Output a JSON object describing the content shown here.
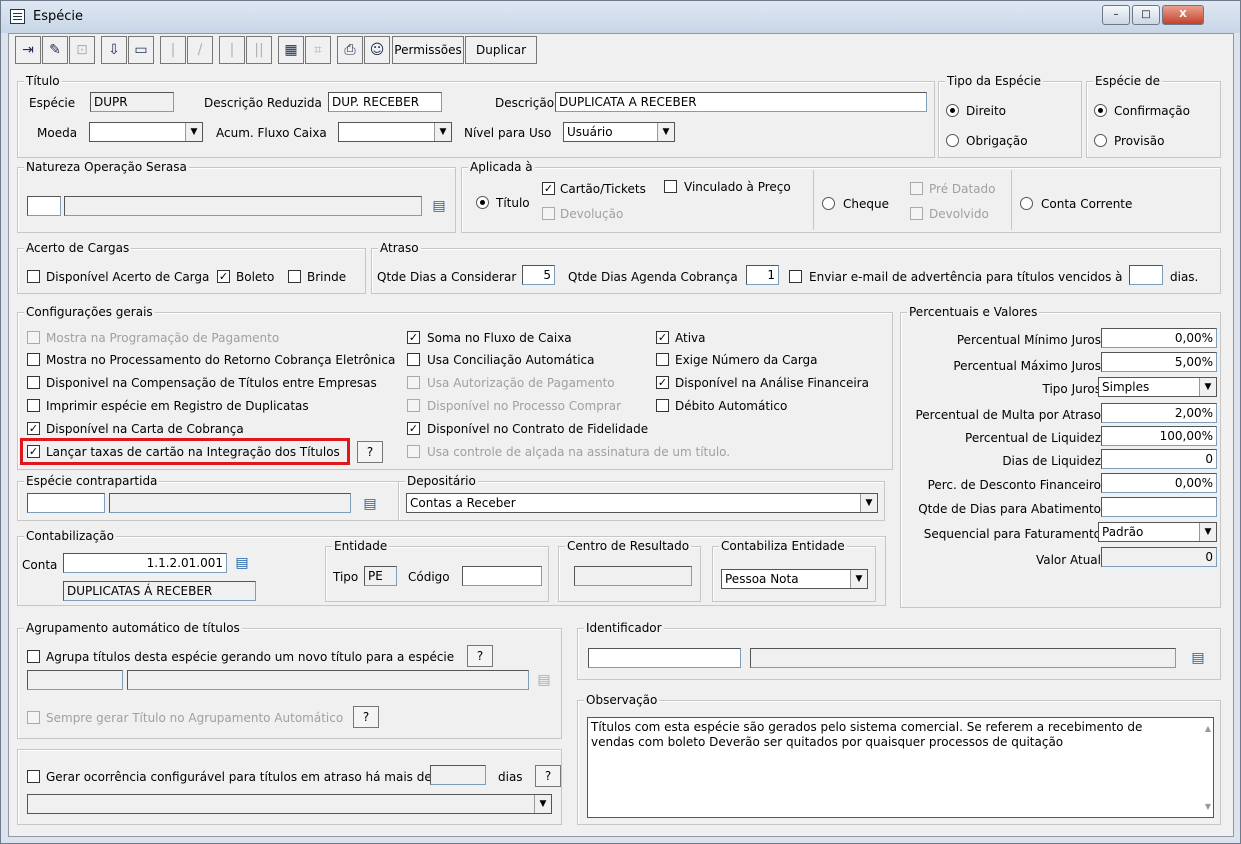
{
  "window": {
    "title": "Espécie",
    "min": "–",
    "max": "□",
    "close": "X"
  },
  "toolbar": {
    "permissoes": "Permissões",
    "duplicar": "Duplicar"
  },
  "titulo": {
    "legend": "Título",
    "especie_label": "Espécie",
    "especie_value": "DUPR",
    "desc_red_label": "Descrição Reduzida",
    "desc_red_value": "DUP. RECEBER",
    "desc_label": "Descrição",
    "desc_value": "DUPLICATA A RECEBER",
    "moeda_label": "Moeda",
    "moeda_value": "",
    "acum_label": "Acum. Fluxo Caixa",
    "acum_value": "",
    "nivel_label": "Nível para Uso",
    "nivel_value": "Usuário"
  },
  "tipo_especie": {
    "legend": "Tipo da Espécie",
    "direito": "Direito",
    "obrigacao": "Obrigação"
  },
  "especie_de": {
    "legend": "Espécie de",
    "confirmacao": "Confirmação",
    "provisao": "Provisão"
  },
  "serasa": {
    "legend": "Natureza Operação Serasa"
  },
  "aplicada": {
    "legend": "Aplicada à",
    "titulo": "Título",
    "cartao": "Cartão/Tickets",
    "vinculado": "Vinculado à Preço",
    "devolucao": "Devolução",
    "cheque": "Cheque",
    "pre_datado": "Pré Datado",
    "devolvido": "Devolvido",
    "conta_corrente": "Conta Corrente"
  },
  "acerto": {
    "legend": "Acerto de Cargas",
    "disponivel": "Disponível Acerto de Carga",
    "boleto": "Boleto",
    "brinde": "Brinde"
  },
  "atraso": {
    "legend": "Atraso",
    "qtde_dias_label": "Qtde Dias a Considerar",
    "qtde_dias_value": "5",
    "agenda_label": "Qtde Dias Agenda Cobrança",
    "agenda_value": "1",
    "email_label": "Enviar e-mail de advertência para títulos vencidos à",
    "email_value": "",
    "dias": "dias."
  },
  "config": {
    "legend": "Configurações gerais",
    "c1": [
      "Mostra na Programação de Pagamento",
      "Mostra no Processamento do Retorno Cobrança Eletrônica",
      "Disponivel na Compensação de Títulos entre Empresas",
      "Imprimir espécie em Registro de Duplicatas",
      "Disponível na Carta de Cobrança",
      "Lançar taxas de cartão na Integração dos Títulos"
    ],
    "c2": [
      "Soma no Fluxo de Caixa",
      "Usa Conciliação Automática",
      "Usa Autorização de Pagamento",
      "Disponível no Processo Comprar",
      "Disponível no Contrato de Fidelidade",
      "Usa controle de alçada na assinatura de um título."
    ],
    "c3": [
      "Ativa",
      "Exige Número da Carga",
      "Disponível na Análise Financeira",
      "Débito Automático"
    ],
    "help": "?"
  },
  "percentuais": {
    "legend": "Percentuais e Valores",
    "rows": [
      {
        "label": "Percentual Mínimo Juros",
        "value": "0,00%"
      },
      {
        "label": "Percentual Máximo Juros",
        "value": "5,00%"
      },
      {
        "label": "Tipo Juros",
        "value": "Simples"
      },
      {
        "label": "Percentual de Multa por Atraso",
        "value": "2,00%"
      },
      {
        "label": "Percentual de Liquidez",
        "value": "100,00%"
      },
      {
        "label": "Dias de Liquidez",
        "value": "0"
      },
      {
        "label": "Perc. de Desconto Financeiro",
        "value": "0,00%"
      },
      {
        "label": "Qtde de Dias para Abatimento",
        "value": ""
      },
      {
        "label": "Sequencial para Faturamento",
        "value": "Padrão"
      },
      {
        "label": "Valor Atual",
        "value": "0"
      }
    ]
  },
  "contrapartida": {
    "legend": "Espécie contrapartida"
  },
  "depositario": {
    "legend": "Depositário",
    "value": "Contas a Receber"
  },
  "contab": {
    "legend": "Contabilização",
    "conta_label": "Conta",
    "conta_value": "1.1.2.01.001",
    "conta_desc": "DUPLICATAS Á RECEBER"
  },
  "entidade": {
    "legend": "Entidade",
    "tipo_label": "Tipo",
    "tipo_value": "PE",
    "codigo_label": "Código"
  },
  "centro": {
    "legend": "Centro de Resultado"
  },
  "contab_entidade": {
    "legend": "Contabiliza Entidade",
    "value": "Pessoa Nota"
  },
  "agrup": {
    "legend": "Agrupamento automático de títulos",
    "agrupa": "Agrupa títulos desta espécie gerando um novo título para a espécie",
    "sempre": "Sempre gerar Título no  Agrupamento Automático"
  },
  "identificador": {
    "legend": "Identificador"
  },
  "observacao": {
    "legend": "Observação",
    "text": "Títulos com esta espécie são gerados pelo sistema comercial. Se referem a recebimento de vendas com boleto  Deverão ser quitados por quaisquer processos de quitação"
  },
  "ocorrencia": {
    "label": "Gerar ocorrência configurável para títulos em atraso há mais de",
    "dias": "dias"
  }
}
